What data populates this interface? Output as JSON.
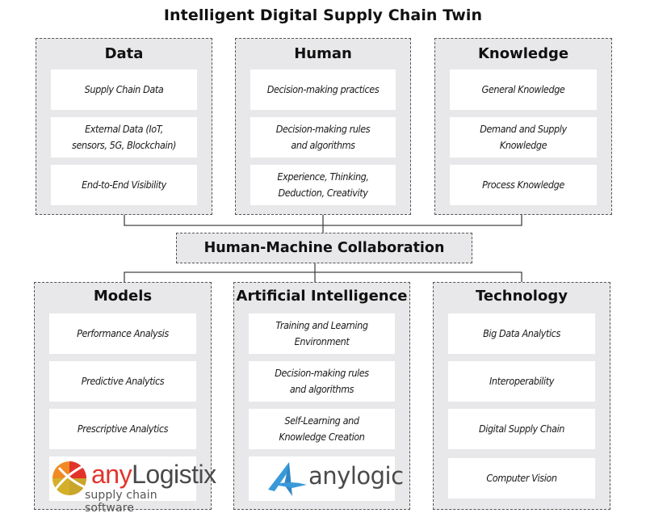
{
  "title": "Intelligent Digital Supply Chain Twin",
  "top_panels": [
    {
      "title": "Data",
      "items": [
        "Supply Chain Data",
        "External Data (IoT,\nsensors, 5G, Blockchain)",
        "End-to-End Visibility"
      ]
    },
    {
      "title": "Human",
      "items": [
        "Decision-making practices",
        "Decision-making rules\nand algorithms",
        "Experience, Thinking,\nDeduction, Creativity"
      ]
    },
    {
      "title": "Knowledge",
      "items": [
        "General Knowledge",
        "Demand and Supply\nKnowledge",
        "Process Knowledge"
      ]
    }
  ],
  "center": {
    "title": "Human-Machine Collaboration"
  },
  "bottom_panels": [
    {
      "title": "Models",
      "items": [
        "Performance Analysis",
        "Predictive Analytics",
        "Prescriptive Analytics"
      ],
      "logo": {
        "name": "anyLogistix",
        "prefix": "any",
        "suffix": "Logistix",
        "tagline": "supply chain software"
      }
    },
    {
      "title": "Artificial Intelligence",
      "items": [
        "Training and Learning\nEnvironment",
        "Decision-making rules\nand algorithms",
        "Self-Learning and\nKnowledge Creation"
      ],
      "logo": {
        "name": "anylogic",
        "text": "anylogic"
      }
    },
    {
      "title": "Technology",
      "items": [
        "Big Data Analytics",
        "Interoperability",
        "Digital Supply Chain",
        "Computer Vision"
      ]
    }
  ],
  "colors": {
    "panel_bg": "#e8e8ea",
    "card_bg": "#ffffff",
    "border": "#555555",
    "anylogistix_red": "#e2332b",
    "anylogic_blue": "#3a9ad9"
  }
}
